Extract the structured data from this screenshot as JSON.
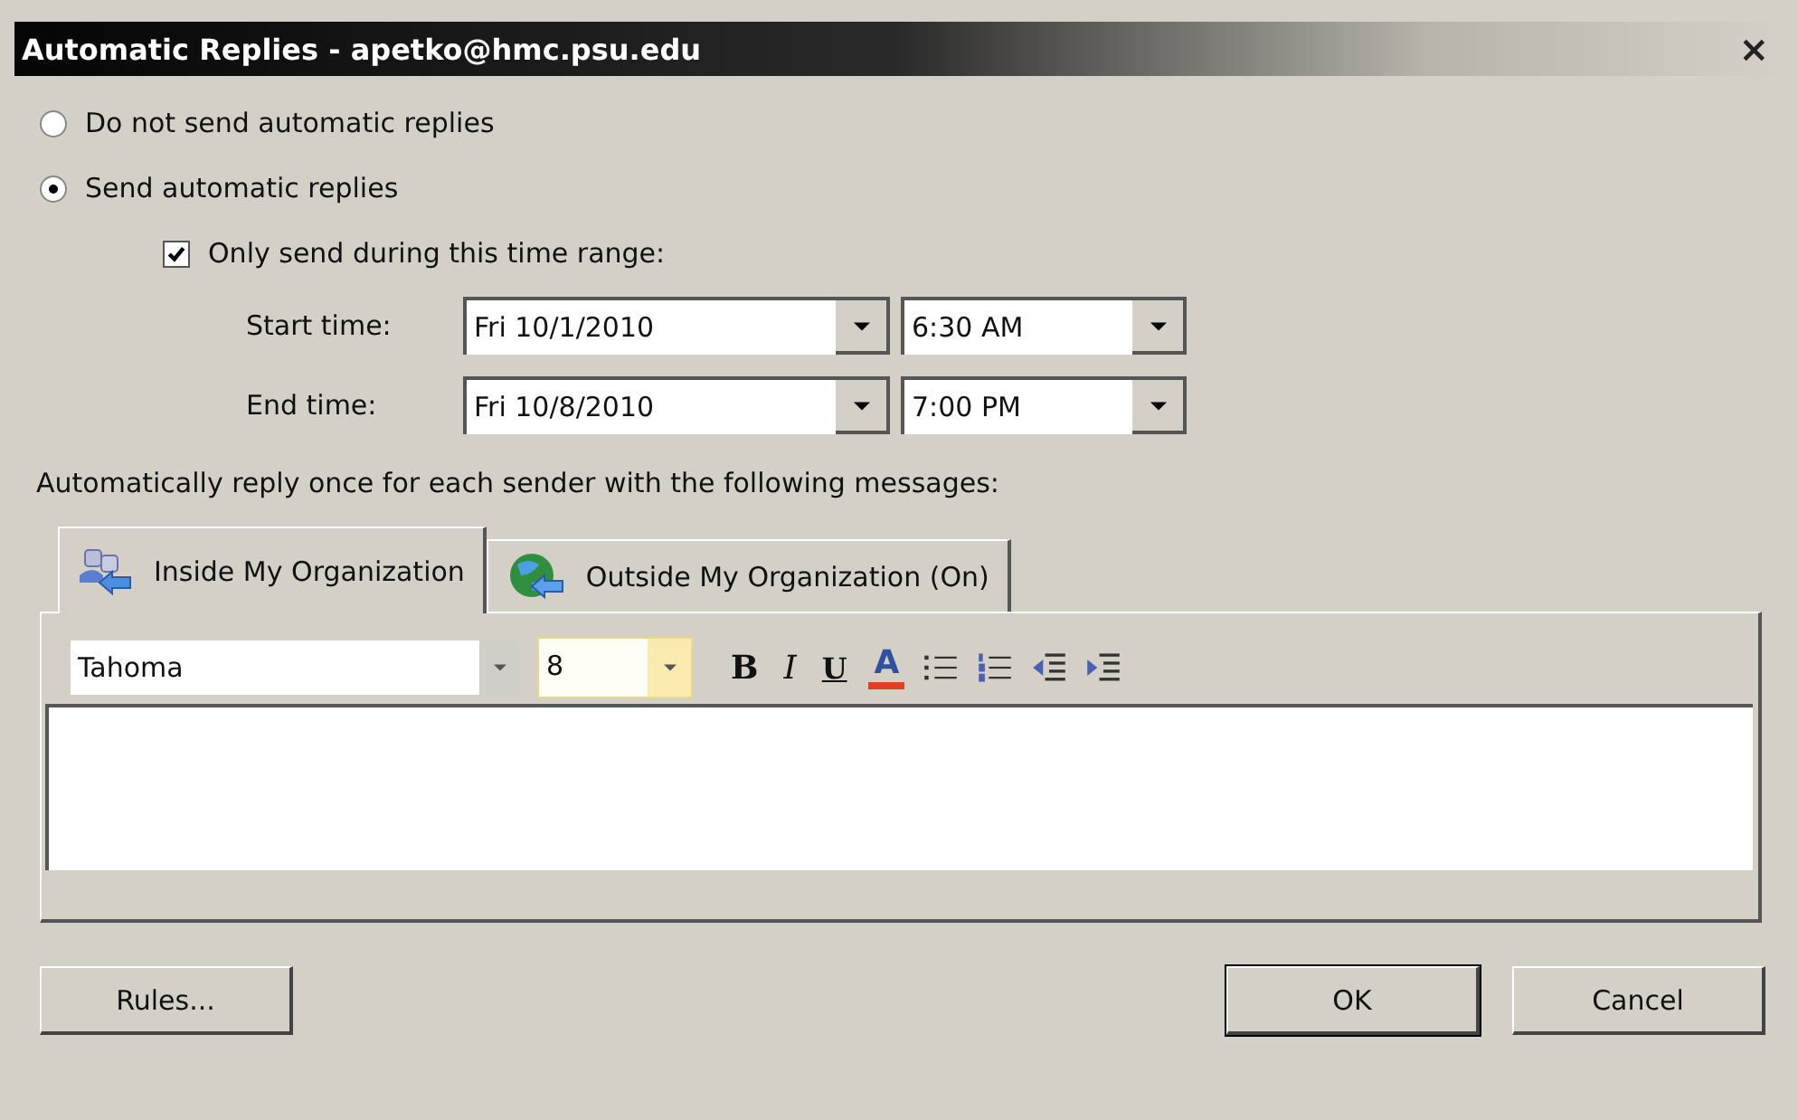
{
  "window": {
    "title": "Automatic Replies - apetko@hmc.psu.edu",
    "close": "×"
  },
  "options": [
    {
      "label": "Do not send automatic replies",
      "selected": false
    },
    {
      "label": "Send automatic replies",
      "selected": true
    }
  ],
  "time_range": {
    "label": "Only send during this time range:",
    "checked": true
  },
  "times": [
    {
      "label": "Start time:",
      "date": "Fri 10/1/2010",
      "time": "6:30 AM"
    },
    {
      "label": "End time:",
      "date": "Fri 10/8/2010",
      "time": "7:00 PM"
    }
  ],
  "reply_label": "Automatically reply once for each sender with the following messages:",
  "tabs": [
    {
      "label": "Inside My Organization",
      "selected": true,
      "kind": "people"
    },
    {
      "label": "Outside My Organization (On)",
      "selected": false,
      "kind": "globe"
    }
  ],
  "toolbar": {
    "font": "Tahoma",
    "size": "8",
    "bold": "B",
    "italic": "I",
    "underline": "U",
    "font_color": "A"
  },
  "buttons": [
    {
      "label": "Rules...",
      "kind": "left"
    },
    {
      "label": "OK",
      "kind": "default"
    },
    {
      "label": "Cancel",
      "kind": "right"
    }
  ]
}
